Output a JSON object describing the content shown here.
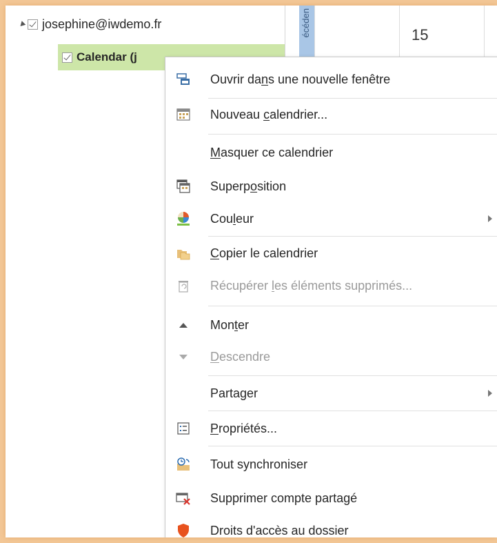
{
  "folder_pane": {
    "account": "josephine@iwdemo.fr",
    "calendar_label": "Calendar (j"
  },
  "calendar": {
    "prev_label": "écéden",
    "day": "15"
  },
  "context_menu": {
    "items": [
      {
        "pre": "Ouvrir da",
        "acc": "n",
        "post": "s une nouvelle fenêtre",
        "icon": "open-new-window-icon",
        "enabled": true
      },
      {
        "pre": "Nouveau ",
        "acc": "c",
        "post": "alendrier...",
        "icon": "new-calendar-icon",
        "enabled": true
      },
      {
        "pre": "",
        "acc": "M",
        "post": "asquer ce calendrier",
        "icon": "",
        "enabled": true
      },
      {
        "pre": "Superp",
        "acc": "o",
        "post": "sition",
        "icon": "overlay-icon",
        "enabled": true
      },
      {
        "pre": "Cou",
        "acc": "l",
        "post": "eur",
        "icon": "color-palette-icon",
        "enabled": true,
        "submenu": true
      },
      {
        "pre": "",
        "acc": "C",
        "post": "opier le calendrier",
        "icon": "copy-calendar-icon",
        "enabled": true
      },
      {
        "pre": "Récupérer ",
        "acc": "l",
        "post": "es éléments supprimés...",
        "icon": "recover-deleted-icon",
        "enabled": false
      },
      {
        "pre": "Mon",
        "acc": "t",
        "post": "er",
        "icon": "move-up-icon",
        "enabled": true
      },
      {
        "pre": "",
        "acc": "D",
        "post": "escendre",
        "icon": "move-down-icon",
        "enabled": false
      },
      {
        "pre": "Parta",
        "acc": "g",
        "post": "er",
        "icon": "",
        "enabled": true,
        "submenu": true
      },
      {
        "pre": "",
        "acc": "P",
        "post": "ropriétés...",
        "icon": "properties-icon",
        "enabled": true
      },
      {
        "pre": "Tout synchroniser",
        "acc": "",
        "post": "",
        "icon": "sync-all-icon",
        "enabled": true
      },
      {
        "pre": "Supprimer compte partagé",
        "acc": "",
        "post": "",
        "icon": "remove-shared-account-icon",
        "enabled": true
      },
      {
        "pre": "Droits d'accès au dossier",
        "acc": "",
        "post": "",
        "icon": "folder-access-rights-icon",
        "enabled": true
      }
    ]
  },
  "colors": {
    "selected_row": "#cde6a8",
    "accent_blue": "#2b6cb0",
    "shield_orange": "#e8521e"
  }
}
